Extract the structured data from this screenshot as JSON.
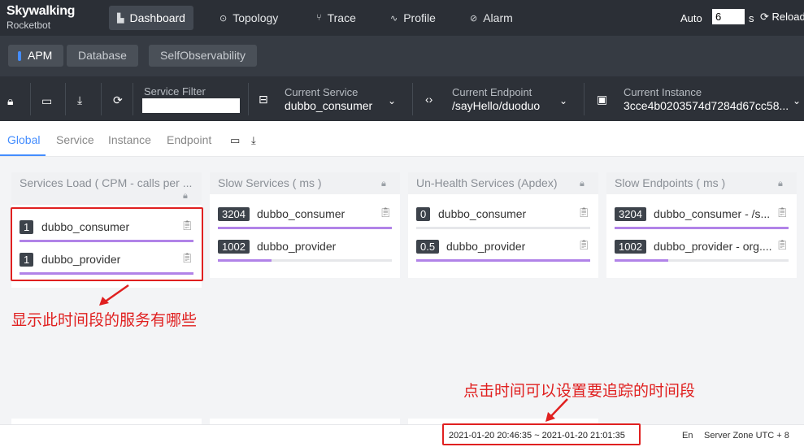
{
  "app": {
    "logo_top": "Skywalking",
    "logo_bottom": "Rocketbot"
  },
  "topnav": {
    "items": [
      {
        "label": "Dashboard",
        "icon": "dashboard-icon",
        "glyph": "▙",
        "active": true
      },
      {
        "label": "Topology",
        "icon": "topology-icon",
        "glyph": "⊙",
        "active": false
      },
      {
        "label": "Trace",
        "icon": "trace-icon",
        "glyph": "⑂",
        "active": false
      },
      {
        "label": "Profile",
        "icon": "profile-icon",
        "glyph": "∿",
        "active": false
      },
      {
        "label": "Alarm",
        "icon": "alarm-icon",
        "glyph": "⊘",
        "active": false
      }
    ],
    "auto_label": "Auto",
    "auto_value": "6",
    "auto_unit": "s",
    "reload_label": "Reload"
  },
  "subnav": {
    "tabs": [
      {
        "label": "APM",
        "active": true
      },
      {
        "label": "Database",
        "active": false
      },
      {
        "label": "SelfObservability",
        "active": false
      }
    ]
  },
  "toolbar": {
    "service_filter_label": "Service Filter",
    "current_service_label": "Current Service",
    "current_service_value": "dubbo_consumer",
    "current_endpoint_label": "Current Endpoint",
    "current_endpoint_value": "/sayHello/duoduo",
    "current_instance_label": "Current Instance",
    "current_instance_value": "3cce4b0203574d7284d67cc58..."
  },
  "pagetabs": {
    "tabs": [
      {
        "label": "Global",
        "active": true
      },
      {
        "label": "Service",
        "active": false
      },
      {
        "label": "Instance",
        "active": false
      },
      {
        "label": "Endpoint",
        "active": false
      }
    ]
  },
  "panels": [
    {
      "title": "Services Load ( CPM - calls per ...",
      "items": [
        {
          "badge": "1",
          "name": "dubbo_consumer",
          "fill": 1.0
        },
        {
          "badge": "1",
          "name": "dubbo_provider",
          "fill": 1.0
        }
      ]
    },
    {
      "title": "Slow Services ( ms )",
      "items": [
        {
          "badge": "3204",
          "name": "dubbo_consumer",
          "fill": 1.0
        },
        {
          "badge": "1002",
          "name": "dubbo_provider",
          "fill": 0.31
        }
      ]
    },
    {
      "title": "Un-Health Services (Apdex)",
      "items": [
        {
          "badge": "0",
          "name": "dubbo_consumer",
          "fill": 0.0
        },
        {
          "badge": "0.5",
          "name": "dubbo_provider",
          "fill": 1.0
        }
      ]
    },
    {
      "title": "Slow Endpoints ( ms )",
      "items": [
        {
          "badge": "3204",
          "name": "dubbo_consumer - /s...",
          "fill": 1.0
        },
        {
          "badge": "1002",
          "name": "dubbo_provider - org....",
          "fill": 0.31
        }
      ]
    }
  ],
  "footer": {
    "time_range": "2021-01-20 20:46:35 ~ 2021-01-20 21:01:35",
    "lang": "En",
    "server_zone": "Server Zone UTC + 8"
  },
  "annotations": {
    "services_note": "显示此时间段的服务有哪些",
    "time_note": "点击时间可以设置要追踪的时间段"
  },
  "colors": {
    "accent": "#448dfe",
    "bar_fill": "#b183e8",
    "annotation": "#e02020"
  }
}
